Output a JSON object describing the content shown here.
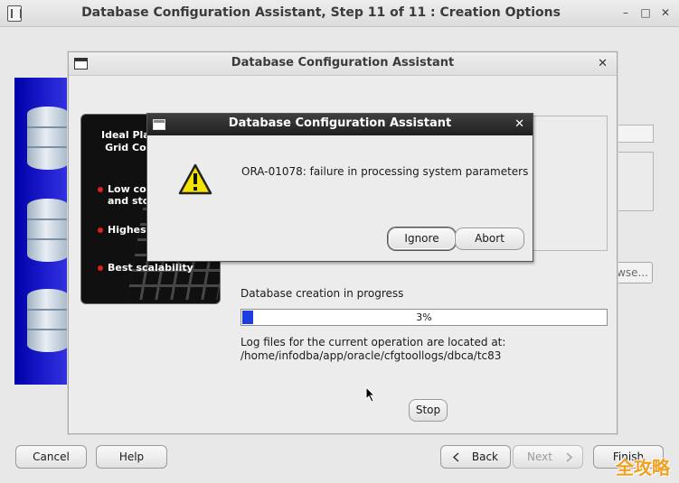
{
  "main_window": {
    "title": "Database Configuration Assistant, Step 11 of 11 : Creation Options",
    "controls": {
      "minimize": "–",
      "maximize": "□",
      "close": "✕"
    },
    "browse_label": "wse...",
    "buttons": {
      "cancel": "Cancel",
      "help": "Help",
      "back": "Back",
      "next": "Next",
      "finish": "Finish"
    }
  },
  "progress_dialog": {
    "title": "Database Configuration Assistant",
    "close": "✕",
    "promo": {
      "heading": "Ideal Pla\nGrid Co",
      "items": [
        "Low co\nand sto",
        "Highest",
        "Best scalability"
      ]
    },
    "status_label": "Database creation in progress",
    "progress_percent": 3,
    "progress_text": "3%",
    "log_line1": "Log files for the current operation are located at:",
    "log_line2": "/home/infodba/app/oracle/cfgtoollogs/dbca/tc83",
    "stop_label": "Stop"
  },
  "error_dialog": {
    "title": "Database Configuration Assistant",
    "close": "✕",
    "message": "ORA-01078: failure in processing system parameters",
    "ignore_label": "Ignore",
    "abort_label": "Abort"
  },
  "watermark": "全攻略",
  "icons": {
    "app": "database-app-icon",
    "warning": "warning-triangle-icon",
    "back": "chevron-left-icon",
    "next": "chevron-right-icon",
    "cursor": "mouse-pointer-icon"
  },
  "colors": {
    "progress_fill": "#1e3de0",
    "warning_yellow": "#f4e200",
    "error_titlebar": "#2a2a2a",
    "bullet_red": "#e0201a"
  }
}
